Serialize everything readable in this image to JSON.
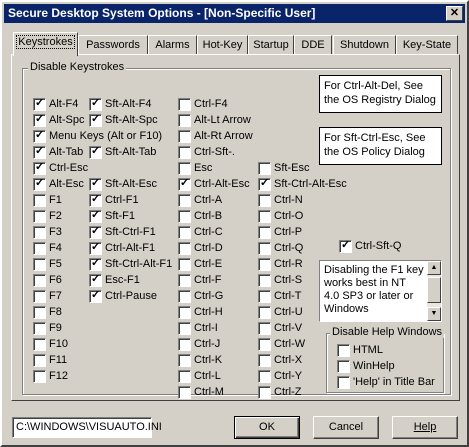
{
  "window": {
    "title": "Secure Desktop System Options - [Non-Specific User]",
    "close_label": "✕"
  },
  "tabs": [
    "Keystrokes",
    "Passwords",
    "Alarms",
    "Hot-Key",
    "Startup",
    "DDE",
    "Shutdown",
    "Key-State"
  ],
  "active_tab": "Keystrokes",
  "disable_keystrokes": {
    "label": "Disable Keystrokes",
    "columns": [
      [
        {
          "label": "Alt-F4",
          "checked": true
        },
        {
          "label": "Alt-Spc",
          "checked": true
        },
        {
          "label": "Menu Keys (Alt or F10)",
          "checked": true
        },
        {
          "label": "Alt-Tab",
          "checked": true
        },
        {
          "label": "Ctrl-Esc",
          "checked": true
        },
        {
          "label": "Alt-Esc",
          "checked": true
        },
        {
          "label": "F1",
          "checked": false
        },
        {
          "label": "F2",
          "checked": false
        },
        {
          "label": "F3",
          "checked": false
        },
        {
          "label": "F4",
          "checked": false
        },
        {
          "label": "F5",
          "checked": false
        },
        {
          "label": "F6",
          "checked": false
        },
        {
          "label": "F7",
          "checked": false
        },
        {
          "label": "F8",
          "checked": false
        },
        {
          "label": "F9",
          "checked": false
        },
        {
          "label": "F10",
          "checked": false
        },
        {
          "label": "F11",
          "checked": false
        },
        {
          "label": "F12",
          "checked": false
        }
      ],
      [
        {
          "label": "Sft-Alt-F4",
          "checked": true
        },
        {
          "label": "Sft-Alt-Spc",
          "checked": true
        },
        {
          "label": "",
          "checked": false,
          "hidden": true
        },
        {
          "label": "Sft-Alt-Tab",
          "checked": true
        },
        {
          "label": "",
          "checked": false,
          "hidden": true
        },
        {
          "label": "Sft-Alt-Esc",
          "checked": true
        },
        {
          "label": "Ctrl-F1",
          "checked": true
        },
        {
          "label": "Sft-F1",
          "checked": true
        },
        {
          "label": "Sft-Ctrl-F1",
          "checked": true
        },
        {
          "label": "Ctrl-Alt-F1",
          "checked": true
        },
        {
          "label": "Sft-Ctrl-Alt-F1",
          "checked": true
        },
        {
          "label": "Esc-F1",
          "checked": true
        },
        {
          "label": "Ctrl-Pause",
          "checked": true
        }
      ],
      [
        {
          "label": "Ctrl-F4",
          "checked": false
        },
        {
          "label": "Alt-Lt Arrow",
          "checked": false
        },
        {
          "label": "Alt-Rt Arrow",
          "checked": false
        },
        {
          "label": "Ctrl-Sft-.",
          "checked": false
        },
        {
          "label": "Esc",
          "checked": false
        },
        {
          "label": "Ctrl-Alt-Esc",
          "checked": true
        },
        {
          "label": "Ctrl-A",
          "checked": false
        },
        {
          "label": "Ctrl-B",
          "checked": false
        },
        {
          "label": "Ctrl-C",
          "checked": false
        },
        {
          "label": "Ctrl-D",
          "checked": false
        },
        {
          "label": "Ctrl-E",
          "checked": false
        },
        {
          "label": "Ctrl-F",
          "checked": false
        },
        {
          "label": "Ctrl-G",
          "checked": false
        },
        {
          "label": "Ctrl-H",
          "checked": false
        },
        {
          "label": "Ctrl-I",
          "checked": false
        },
        {
          "label": "Ctrl-J",
          "checked": false
        },
        {
          "label": "Ctrl-K",
          "checked": false
        },
        {
          "label": "Ctrl-L",
          "checked": false
        },
        {
          "label": "Ctrl-M",
          "checked": false
        }
      ],
      [
        {
          "label": "Sft-Esc",
          "checked": false
        },
        {
          "label": "Sft-Ctrl-Alt-Esc",
          "checked": true
        },
        {
          "label": "Ctrl-N",
          "checked": false
        },
        {
          "label": "Ctrl-O",
          "checked": false
        },
        {
          "label": "Ctrl-P",
          "checked": false
        },
        {
          "label": "Ctrl-Q",
          "checked": false
        },
        {
          "label": "Ctrl-R",
          "checked": false
        },
        {
          "label": "Ctrl-S",
          "checked": false
        },
        {
          "label": "Ctrl-T",
          "checked": false
        },
        {
          "label": "Ctrl-U",
          "checked": false
        },
        {
          "label": "Ctrl-V",
          "checked": false
        },
        {
          "label": "Ctrl-W",
          "checked": false
        },
        {
          "label": "Ctrl-X",
          "checked": false
        },
        {
          "label": "Ctrl-Y",
          "checked": false
        },
        {
          "label": "Ctrl-Z",
          "checked": false
        }
      ]
    ],
    "ctrl_sft_q": {
      "label": "Ctrl-Sft-Q",
      "checked": true
    }
  },
  "info": {
    "ctrl_alt_del": "For Ctrl-Alt-Del, See the OS Registry Dialog",
    "sft_ctrl_esc": "For Sft-Ctrl-Esc, See the OS Policy Dialog",
    "f1_note": "Disabling the F1 key works best in NT 4.0 SP3 or later or Windows"
  },
  "disable_help": {
    "label": "Disable Help Windows",
    "items": [
      {
        "label": "HTML",
        "checked": false
      },
      {
        "label": "WinHelp",
        "checked": false
      },
      {
        "label": "'Help' in Title Bar",
        "checked": false
      }
    ]
  },
  "footer": {
    "path": "C:\\WINDOWS\\VISUAUTO.INI",
    "ok_label": "OK",
    "cancel_label": "Cancel",
    "help_label": "Help"
  }
}
